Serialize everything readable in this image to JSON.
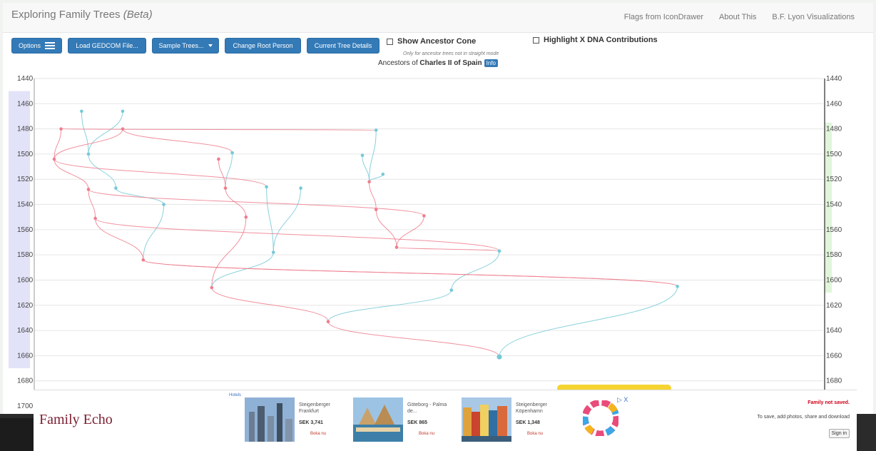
{
  "app": {
    "title": "Exploring Family Trees",
    "beta": "(Beta)"
  },
  "nav": {
    "links": [
      "Flags from IconDrawer",
      "About This",
      "B.F. Lyon Visualizations"
    ]
  },
  "toolbar": {
    "options_label": "Options",
    "load_label": "Load GEDCOM File...",
    "sample_label": "Sample Trees...",
    "change_root_label": "Change Root Person",
    "current_tree_label": "Current Tree Details",
    "show_cone_label": "Show Ancestor Cone",
    "show_cone_note": "Only for ancestor trees not in straight mode",
    "highlight_x_label": "Highlight X DNA Contributions"
  },
  "chart_title": {
    "prefix": "Ancestors of",
    "name": "Charles II of Spain",
    "info": "Info"
  },
  "colors": {
    "male": "#74c9d6",
    "female": "#ef7d8d",
    "left_axis_band": "#e2e2f8",
    "right_axis_band": "#e0f5da",
    "primary": "#337ab7"
  },
  "chart_data": {
    "type": "scatter",
    "y_axis": {
      "ticks": [
        1440,
        1460,
        1480,
        1500,
        1520,
        1540,
        1560,
        1580,
        1600,
        1620,
        1640,
        1660,
        1680,
        1700
      ],
      "ylim": [
        1440,
        1700
      ],
      "reversed": true
    },
    "grid": true,
    "series": [
      {
        "name": "",
        "points": [
          {
            "x": 0.4,
            "y": 1466,
            "s": "m"
          },
          {
            "x": 1.0,
            "y": 1466,
            "s": "m"
          },
          {
            "x": 1.0,
            "y": 1480,
            "s": "f"
          },
          {
            "x": 0.1,
            "y": 1480,
            "s": "f"
          },
          {
            "x": 0.5,
            "y": 1500,
            "s": "m"
          },
          {
            "x": 4.5,
            "y": 1501,
            "s": "m"
          },
          {
            "x": 2.6,
            "y": 1499,
            "s": "m"
          },
          {
            "x": 0.0,
            "y": 1504,
            "s": "f"
          },
          {
            "x": 2.4,
            "y": 1504,
            "s": "f"
          },
          {
            "x": 4.7,
            "y": 1481,
            "s": "m"
          },
          {
            "x": 4.8,
            "y": 1516,
            "s": "m"
          },
          {
            "x": 4.6,
            "y": 1522,
            "s": "f"
          },
          {
            "x": 0.5,
            "y": 1528,
            "s": "f"
          },
          {
            "x": 0.9,
            "y": 1527,
            "s": "m"
          },
          {
            "x": 2.5,
            "y": 1527,
            "s": "f"
          },
          {
            "x": 3.1,
            "y": 1526,
            "s": "m"
          },
          {
            "x": 3.6,
            "y": 1527,
            "s": "m"
          },
          {
            "x": 1.6,
            "y": 1540,
            "s": "m"
          },
          {
            "x": 4.7,
            "y": 1544,
            "s": "f"
          },
          {
            "x": 5.4,
            "y": 1549,
            "s": "f"
          },
          {
            "x": 0.6,
            "y": 1551,
            "s": "f"
          },
          {
            "x": 2.8,
            "y": 1550,
            "s": "f"
          },
          {
            "x": 5.0,
            "y": 1574,
            "s": "f"
          },
          {
            "x": 3.2,
            "y": 1578,
            "s": "m"
          },
          {
            "x": 6.5,
            "y": 1577,
            "s": "m"
          },
          {
            "x": 1.3,
            "y": 1584,
            "s": "f"
          },
          {
            "x": 2.3,
            "y": 1606,
            "s": "f"
          },
          {
            "x": 5.8,
            "y": 1608,
            "s": "m"
          },
          {
            "x": 9.1,
            "y": 1605,
            "s": "m"
          },
          {
            "x": 4.0,
            "y": 1633,
            "s": "f"
          },
          {
            "x": 6.5,
            "y": 1661,
            "s": "m"
          }
        ]
      }
    ]
  },
  "ad": {
    "logo": "Family Echo",
    "tag": "Hotels",
    "close": "▷ X",
    "cards": [
      {
        "name": "Steigenberger Frankfurt",
        "price": "SEK 3,741",
        "book": "Boka nu"
      },
      {
        "name": "Göteborg - Palma de...",
        "price": "SEK 865",
        "book": "Boka nu"
      },
      {
        "name": "Steigenberger Köpenhamn",
        "price": "SEK 1,348",
        "book": "Boka nu"
      }
    ],
    "not_saved": "Family not saved.",
    "promo": "To save, add photos, share and download",
    "signin": "Sign in"
  }
}
